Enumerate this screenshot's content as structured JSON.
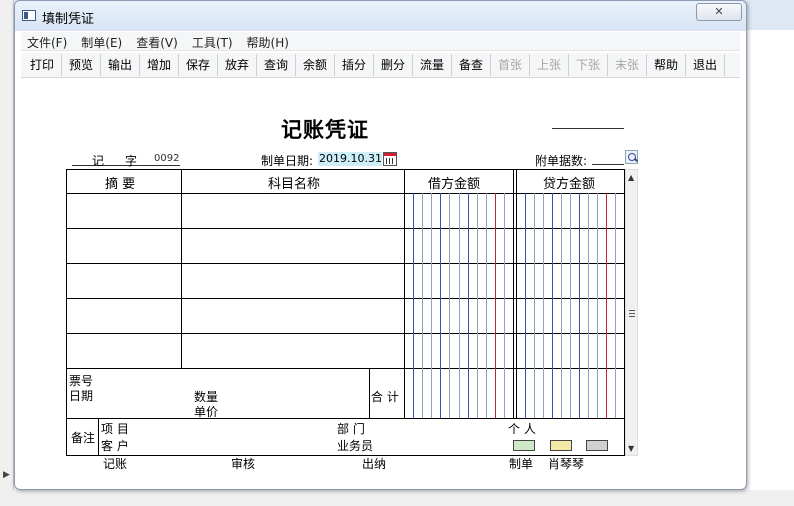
{
  "window": {
    "title": "填制凭证",
    "close_label": "✕"
  },
  "menu": [
    "文件(F)",
    "制单(E)",
    "查看(V)",
    "工具(T)",
    "帮助(H)"
  ],
  "toolbar": [
    {
      "label": "打印",
      "enabled": true
    },
    {
      "label": "预览",
      "enabled": true
    },
    {
      "label": "输出",
      "enabled": true
    },
    {
      "label": "增加",
      "enabled": true
    },
    {
      "label": "保存",
      "enabled": true
    },
    {
      "label": "放弃",
      "enabled": true
    },
    {
      "label": "查询",
      "enabled": true
    },
    {
      "label": "余额",
      "enabled": true
    },
    {
      "label": "插分",
      "enabled": true
    },
    {
      "label": "删分",
      "enabled": true
    },
    {
      "label": "流量",
      "enabled": true
    },
    {
      "label": "备查",
      "enabled": true
    },
    {
      "label": "首张",
      "enabled": false
    },
    {
      "label": "上张",
      "enabled": false
    },
    {
      "label": "下张",
      "enabled": false
    },
    {
      "label": "末张",
      "enabled": false
    },
    {
      "label": "帮助",
      "enabled": true
    },
    {
      "label": "退出",
      "enabled": true
    }
  ],
  "voucher": {
    "title": "记账凭证",
    "word_1": "记",
    "word_2": "字",
    "number": "0092",
    "date_label": "制单日期:",
    "date": "2019.10.31",
    "attach_label": "附单据数:",
    "attach_count": ""
  },
  "table": {
    "headers": {
      "summary": "摘 要",
      "account": "科目名称",
      "debit": "借方金额",
      "credit": "贷方金额"
    },
    "rows": [
      {
        "summary": "",
        "account": "",
        "debit": "",
        "credit": ""
      },
      {
        "summary": "",
        "account": "",
        "debit": "",
        "credit": ""
      },
      {
        "summary": "",
        "account": "",
        "debit": "",
        "credit": ""
      },
      {
        "summary": "",
        "account": "",
        "debit": "",
        "credit": ""
      },
      {
        "summary": "",
        "account": "",
        "debit": "",
        "credit": ""
      }
    ],
    "ticket_no_label": "票号",
    "date_label": "日期",
    "qty_label": "数量",
    "price_label": "单价",
    "total_label": "合 计",
    "remark_label": "备注",
    "project_label": "项  目",
    "customer_label": "客  户",
    "dept_label": "部  门",
    "salesman_label": "业务员",
    "person_label": "个  人"
  },
  "footer": {
    "bookkeep_label": "记账",
    "audit_label": "审核",
    "cashier_label": "出纳",
    "maker_label": "制单",
    "maker_name": "肖琴琴"
  },
  "colors": {
    "blue_line": "#3b4fb8",
    "red_line": "#c0282e",
    "date_bg": "#cdeef9"
  }
}
